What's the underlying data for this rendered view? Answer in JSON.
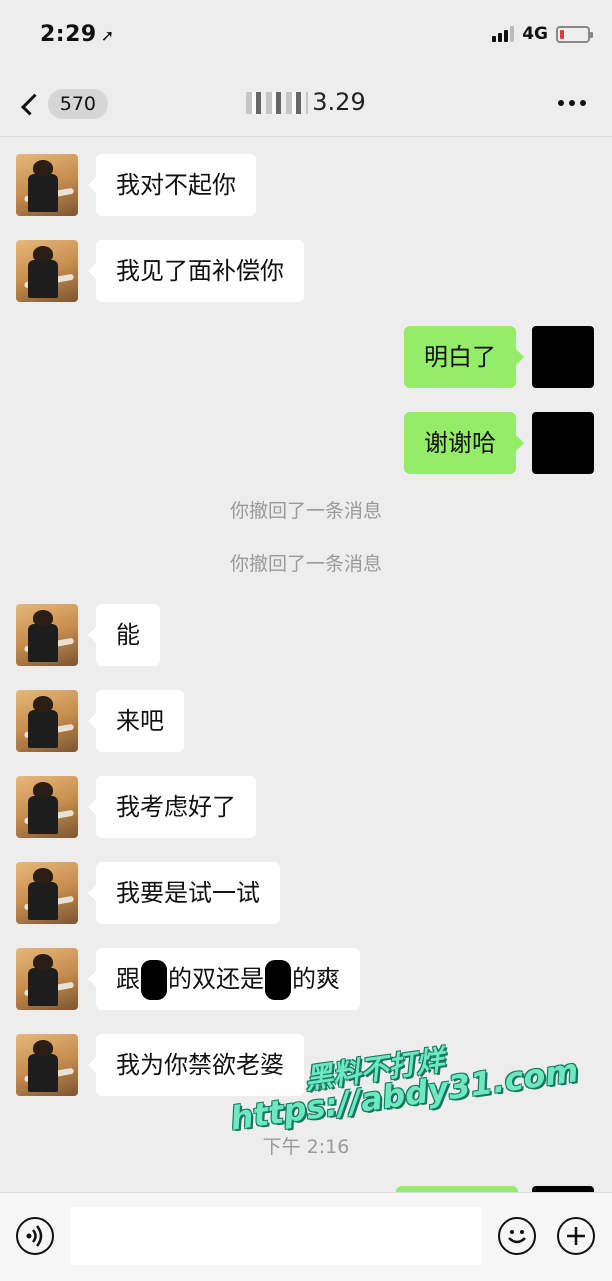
{
  "status_bar": {
    "time": "2:29",
    "network": "4G"
  },
  "nav": {
    "unread_count": "570",
    "title": "3.29"
  },
  "messages": [
    {
      "side": "left",
      "text": "我对不起你"
    },
    {
      "side": "left",
      "text": "我见了面补偿你"
    },
    {
      "side": "right",
      "text": "明白了"
    },
    {
      "side": "right",
      "text": "谢谢哈"
    },
    {
      "side": "system",
      "text": "你撤回了一条消息"
    },
    {
      "side": "system",
      "text": "你撤回了一条消息"
    },
    {
      "side": "left",
      "text": "能"
    },
    {
      "side": "left",
      "text": "来吧"
    },
    {
      "side": "left",
      "text": "我考虑好了"
    },
    {
      "side": "left",
      "text": "我要是试一试"
    },
    {
      "side": "left",
      "parts": [
        "跟",
        "的双还是",
        "的爽"
      ]
    },
    {
      "side": "left",
      "text": "我为你禁欲老婆"
    }
  ],
  "timestamp": "下午 2:16",
  "watermark": {
    "line1": "黑料不打烊",
    "line2": "https://abdy31.com"
  },
  "colors": {
    "background": "#ededed",
    "sent_bubble": "#95ec69",
    "received_bubble": "#ffffff",
    "system_text": "#9a9a9a"
  },
  "icons": {
    "back": "chevron-left-icon",
    "more": "more-dots-icon",
    "voice": "voice-icon",
    "emoji": "emoji-icon",
    "plus": "plus-icon"
  }
}
